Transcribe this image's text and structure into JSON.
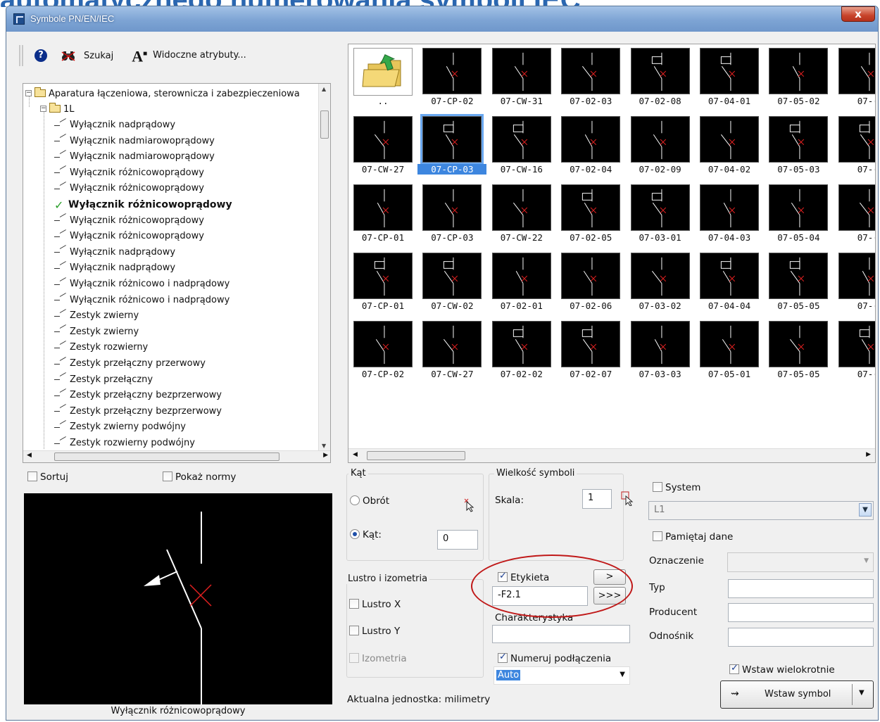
{
  "background_title": "automatycznego numerowania symboli IEC",
  "window": {
    "title": "Symbole PN/EN/IEC",
    "close_label": "x"
  },
  "toolbar": {
    "search_label": "Szukaj",
    "attributes_label": "Widoczne atrybuty..."
  },
  "tree": {
    "root": "Aparatura łączeniowa, sterownicza i zabezpieczeniowa",
    "group": "1L",
    "items": [
      "Wyłącznik nadprądowy",
      "Wyłącznik nadmiarowoprądowy",
      "Wyłącznik nadmiarowoprądowy",
      "Wyłącznik różnicowoprądowy",
      "Wyłącznik różnicowoprądowy",
      "Wyłącznik różnicowoprądowy",
      "Wyłącznik różnicowoprądowy",
      "Wyłącznik różnicowoprądowy",
      "Wyłącznik nadprądowy",
      "Wyłącznik nadprądowy",
      "Wyłącznik różnicowo i nadprądowy",
      "Wyłącznik różnicowo i nadprądowy",
      "Zestyk zwierny",
      "Zestyk zwierny",
      "Zestyk rozwierny",
      "Zestyk przełączny przerwowy",
      "Zestyk przełączny",
      "Zestyk przełączny bezprzerwowy",
      "Zestyk przełączny bezprzerwowy",
      "Zestyk zwierny podwójny",
      "Zestyk rozwierny podwójny"
    ],
    "selected_index": 5
  },
  "grid": {
    "up_label": "..",
    "cells": [
      "07-CP-02",
      "07-CW-31",
      "07-02-03",
      "07-02-08",
      "07-04-01",
      "07-05-02",
      "07-(",
      "07-CW-27",
      "07-CP-03",
      "07-CW-16",
      "07-02-04",
      "07-02-09",
      "07-04-02",
      "07-05-03",
      "07-(",
      "07-CP-01",
      "07-CP-03",
      "07-CW-22",
      "07-02-05",
      "07-03-01",
      "07-04-03",
      "07-05-04",
      "07-(",
      "07-CP-01",
      "07-CW-02",
      "07-02-01",
      "07-02-06",
      "07-03-02",
      "07-04-04",
      "07-05-05",
      "07-(",
      "07-CP-02",
      "07-CW-27",
      "07-02-02",
      "07-02-07",
      "07-03-03",
      "07-05-01",
      "07-05-05",
      "07-("
    ],
    "selected_label": "07-CP-03"
  },
  "options": {
    "sort_label": "Sortuj",
    "show_norms_label": "Pokaż normy"
  },
  "preview": {
    "caption": "Wyłącznik różnicowoprądowy"
  },
  "angle": {
    "title": "Kąt",
    "rotation_label": "Obrót",
    "angle_label": "Kąt:",
    "angle_value": "0"
  },
  "size": {
    "title": "Wielkość symboli",
    "scale_label": "Skala:",
    "scale_value": "1"
  },
  "mirror": {
    "title": "Lustro i izometria",
    "mirror_x": "Lustro X",
    "mirror_y": "Lustro Y",
    "isometry": "Izometria"
  },
  "label": {
    "checkbox": "Etykieta",
    "value": "-F2.1",
    "btn_single": ">",
    "btn_multi": ">>>",
    "characteristic_label": "Charakterystyka",
    "characteristic_value": ""
  },
  "connections": {
    "checkbox": "Numeruj podłączenia",
    "value": "Auto"
  },
  "unit_text": "Aktualna jednostka: milimetry",
  "system": {
    "checkbox": "System",
    "value": "L1",
    "remember": "Pamiętaj dane"
  },
  "fields": {
    "designation": "Oznaczenie",
    "type": "Typ",
    "producer": "Producent",
    "reference": "Odnośnik"
  },
  "insert": {
    "multiple": "Wstaw wielokrotnie",
    "button": "Wstaw symbol"
  }
}
